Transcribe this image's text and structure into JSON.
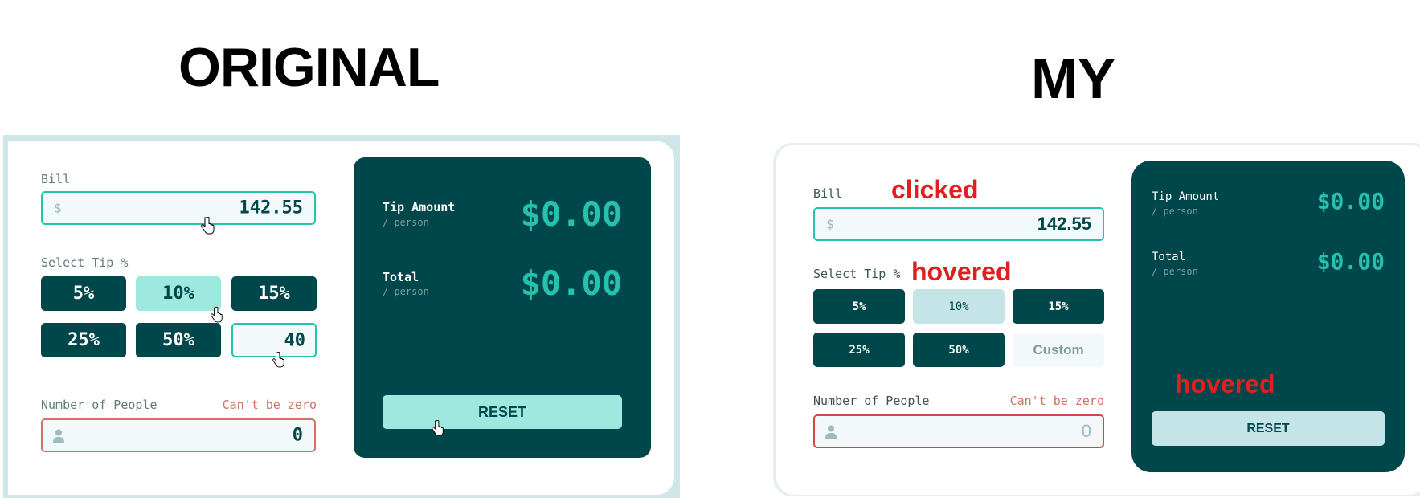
{
  "headings": {
    "left": "ORIGINAL",
    "right": "MY"
  },
  "colors": {
    "dark_cyan": "#00474b",
    "strong_cyan": "#26c2ae",
    "hover_cyan": "#9fe8df",
    "light_field": "#f3f9fa",
    "error": "#d27260",
    "annotation": "#e02020"
  },
  "original": {
    "bill_label": "Bill",
    "bill_icon": "$",
    "bill_value": "142.55",
    "tip_label": "Select Tip %",
    "tips": [
      "5%",
      "10%",
      "15%",
      "25%",
      "50%"
    ],
    "custom_value": "40",
    "people_label": "Number of People",
    "error_text": "Can't be zero",
    "people_value": "0",
    "tip_amount_label": "Tip Amount",
    "tip_amount_sub": "/ person",
    "tip_amount_value": "$0.00",
    "total_label": "Total",
    "total_sub": "/ person",
    "total_value": "$0.00",
    "reset_label": "RESET"
  },
  "my": {
    "bill_label": "Bill",
    "bill_icon": "$",
    "bill_value": "142.55",
    "tip_label": "Select Tip %",
    "tips": [
      "5%",
      "10%",
      "15%",
      "25%",
      "50%"
    ],
    "custom_placeholder": "Custom",
    "people_label": "Number of People",
    "error_text": "Can't be zero",
    "people_value": "0",
    "tip_amount_label": "Tip Amount",
    "tip_amount_sub": "/ person",
    "tip_amount_value": "$0.00",
    "total_label": "Total",
    "total_sub": "/ person",
    "total_value": "$0.00",
    "reset_label": "RESET",
    "annotations": {
      "clicked": "clicked",
      "hovered_tip": "hovered",
      "hovered_reset": "hovered"
    }
  }
}
